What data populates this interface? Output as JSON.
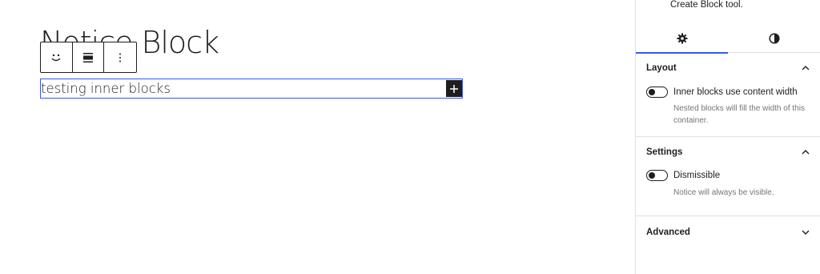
{
  "editor": {
    "title": "Notice Block",
    "inner_block_text": "testing inner blocks",
    "toolbar": {
      "items": [
        {
          "name": "block-type-icon",
          "icon": "smiley-icon"
        },
        {
          "name": "align-button",
          "icon": "align-center-icon"
        },
        {
          "name": "options-button",
          "icon": "more-vertical-icon"
        }
      ]
    },
    "inserter_label": "+"
  },
  "sidebar": {
    "description_tail": "Create Block tool.",
    "tabs": [
      {
        "name": "settings",
        "icon": "gear-icon",
        "active": true
      },
      {
        "name": "styles",
        "icon": "half-circle-icon",
        "active": false
      }
    ],
    "panels": {
      "layout": {
        "title": "Layout",
        "expanded": true,
        "toggle_label": "Inner blocks use content width",
        "toggle_on": false,
        "help": "Nested blocks will fill the width of this container."
      },
      "settings": {
        "title": "Settings",
        "expanded": true,
        "toggle_label": "Dismissible",
        "toggle_on": false,
        "help": "Notice will always be visible."
      },
      "advanced": {
        "title": "Advanced",
        "expanded": false
      }
    }
  },
  "colors": {
    "accent": "#3858e9",
    "text": "#1e1e1e",
    "muted": "#757575",
    "border": "#e0e0e0"
  }
}
